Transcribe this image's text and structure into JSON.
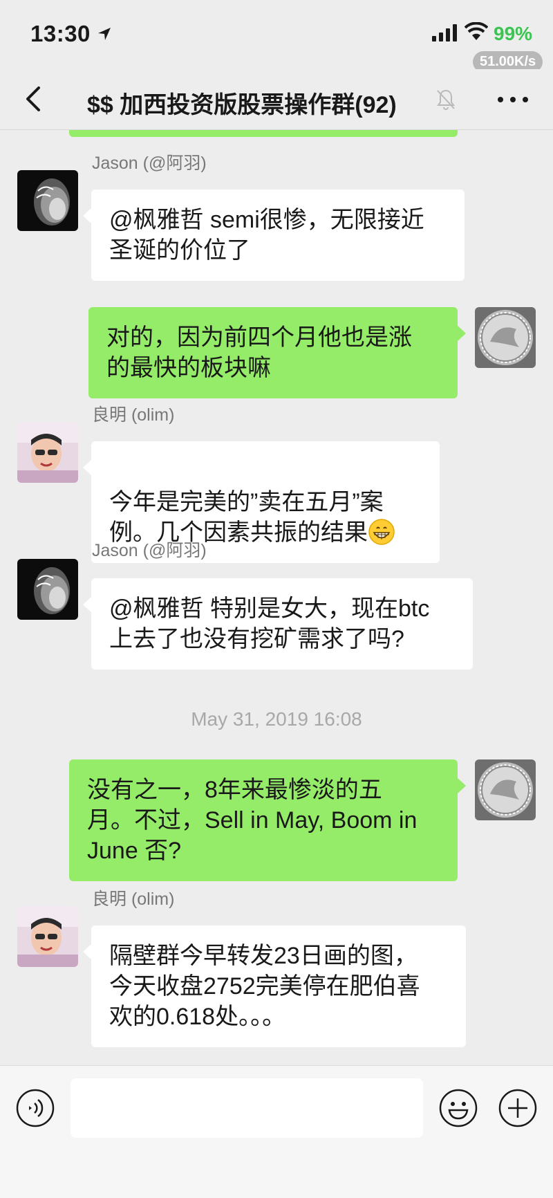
{
  "status_bar": {
    "time": "13:30",
    "battery_percent": "99%",
    "net_speed": "51.00K/s",
    "battery_color": "#3bc451"
  },
  "nav": {
    "title": "$$ 加西投资版股票操作群(92)",
    "icons": [
      "chevron-left-icon",
      "mute-bell-icon",
      "more-icon"
    ]
  },
  "messages": [
    {
      "type": "outgoing",
      "text": "",
      "partial": true
    },
    {
      "type": "incoming",
      "sender": "Jason (@阿羽)",
      "text": "@枫雅哲 semi很惨，无限接近\n圣诞的价位了"
    },
    {
      "type": "outgoing",
      "text": "对的，因为前四个月他也是涨\n的最快的板块嘛"
    },
    {
      "type": "incoming",
      "sender": "良明 (olim)",
      "text": "今年是完美的”卖在五月”案\n例。几个因素共振的结果",
      "emoji": "grinning-face-icon"
    },
    {
      "type": "incoming",
      "sender": "Jason (@阿羽)",
      "text": "@枫雅哲 特别是女大，现在btc\n上去了也没有挖矿需求了吗?"
    },
    {
      "type": "timestamp",
      "text": "May 31, 2019 16:08"
    },
    {
      "type": "outgoing",
      "text": "没有之一，8年来最惨淡的五\n月。不过，Sell in May, Boom in\n June 否?"
    },
    {
      "type": "incoming",
      "sender": "良明 (olim)",
      "text": "隔壁群今早转发23日画的图，\n今天收盘2752完美停在肥伯喜\n欢的0.618处。。。"
    }
  ],
  "input_bar": {
    "placeholder": "",
    "icons": [
      "voice-icon",
      "emoji-icon",
      "plus-icon"
    ]
  },
  "colors": {
    "background": "#ededed",
    "outgoing_bubble": "#95ec69",
    "incoming_bubble": "#ffffff"
  }
}
